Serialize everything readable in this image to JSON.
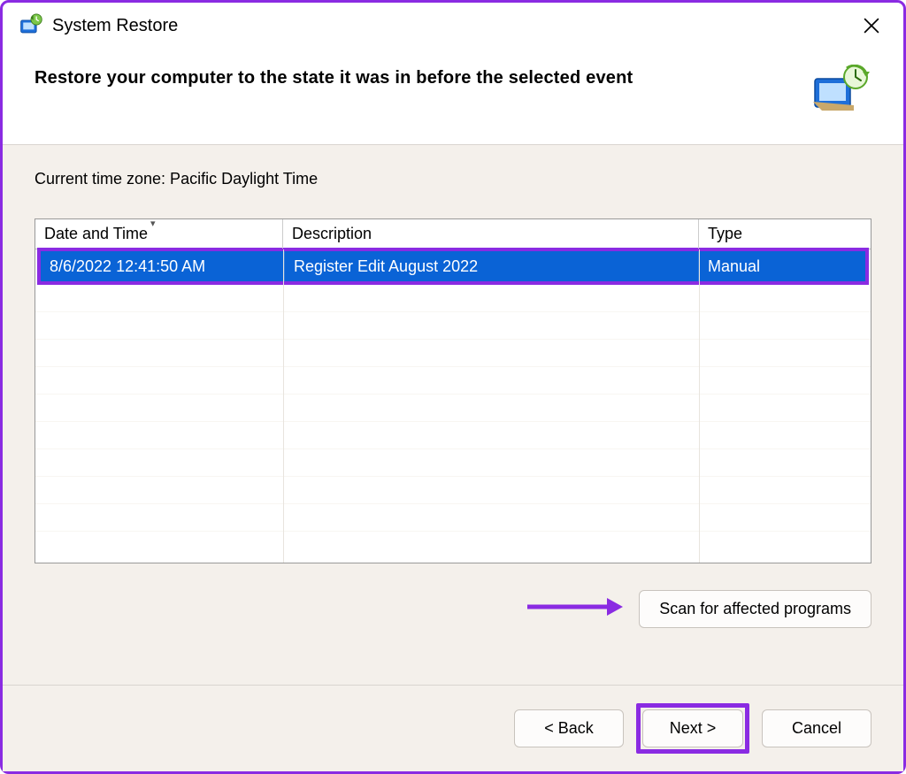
{
  "window": {
    "title": "System Restore",
    "heading": "Restore your computer to the state it was in before the selected event",
    "timezone_label": "Current time zone: Pacific Daylight Time"
  },
  "table": {
    "columns": {
      "date": "Date and Time",
      "description": "Description",
      "type": "Type"
    },
    "rows": [
      {
        "date": "8/6/2022 12:41:50 AM",
        "description": "Register Edit August 2022",
        "type": "Manual"
      }
    ]
  },
  "buttons": {
    "scan": "Scan for affected programs",
    "back": "< Back",
    "next": "Next >",
    "cancel": "Cancel"
  },
  "colors": {
    "highlight": "#8a2be2",
    "selection": "#0a63d6"
  }
}
